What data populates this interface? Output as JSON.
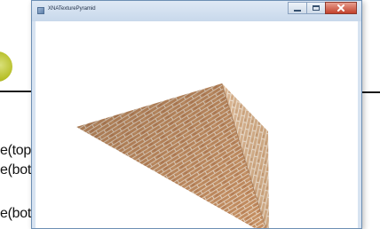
{
  "background_slide": {
    "code_lines": [
      "e(top, leftNormal, textureTop);",
      "e(bottomLeftFront, leftNormal,",
      "e(bottomLeftBack, leftNormal,"
    ]
  },
  "window": {
    "title": "XNATexturePyramid",
    "controls": {
      "minimize_icon": "minimize-icon",
      "maximize_icon": "maximize-icon",
      "close_icon": "close-icon"
    }
  },
  "scene": {
    "object": "textured-pyramid",
    "texture": "brick",
    "colors": {
      "face_left": "#c68f62",
      "face_right": "#d8b089",
      "mortar": "#e9d6c2",
      "background": "#ffffff"
    }
  }
}
